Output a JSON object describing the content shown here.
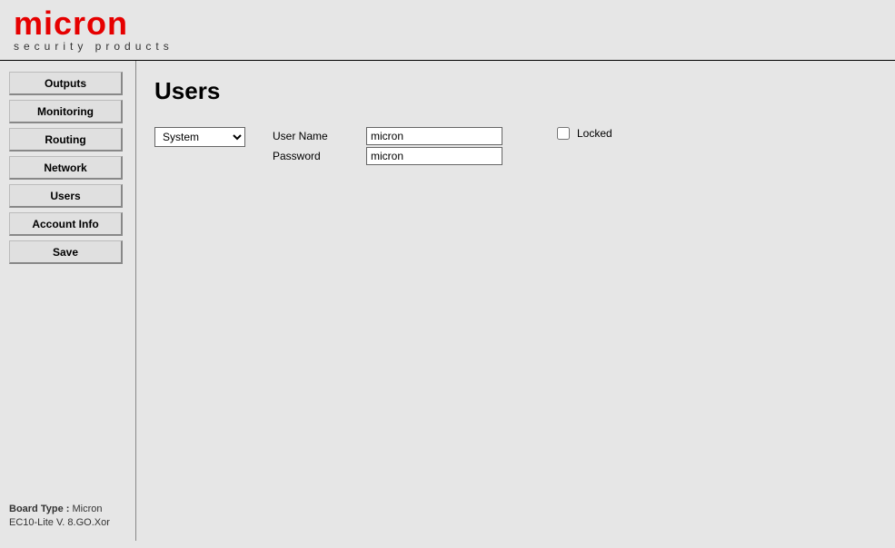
{
  "header": {
    "brand": "micron",
    "tagline": "security products"
  },
  "sidebar": {
    "items": [
      {
        "label": "Outputs"
      },
      {
        "label": "Monitoring"
      },
      {
        "label": "Routing"
      },
      {
        "label": "Network"
      },
      {
        "label": "Users"
      },
      {
        "label": "Account Info"
      },
      {
        "label": "Save"
      }
    ],
    "footer": {
      "board_label": "Board Type :",
      "board_value": " Micron",
      "version": "EC10-Lite V. 8.GO.Xor"
    }
  },
  "main": {
    "title": "Users",
    "user_select": {
      "selected": "System"
    },
    "username_label": "User Name",
    "username_value": "micron",
    "password_label": "Password",
    "password_value": "micron",
    "locked_label": "Locked",
    "locked_checked": false
  }
}
